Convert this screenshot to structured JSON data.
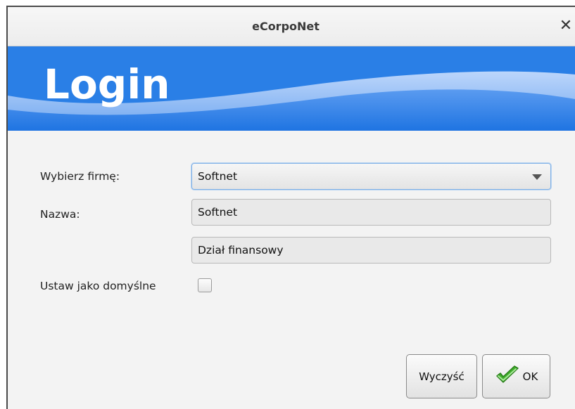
{
  "window": {
    "title": "eCorpoNet",
    "close_glyph": "✕"
  },
  "banner": {
    "title": "Login",
    "color": "#2a7fe6"
  },
  "form": {
    "company": {
      "label": "Wybierz firmę:",
      "selected": "Softnet"
    },
    "name": {
      "label": "Nazwa:",
      "value": "Softnet"
    },
    "department": {
      "value": "Dział finansowy"
    },
    "default": {
      "label": "Ustaw jako domyślne",
      "checked": false
    }
  },
  "buttons": {
    "clear_label": "Wyczyść",
    "ok_label": "OK",
    "ok_icon": "check-icon",
    "ok_icon_color": "#3fae2a"
  }
}
